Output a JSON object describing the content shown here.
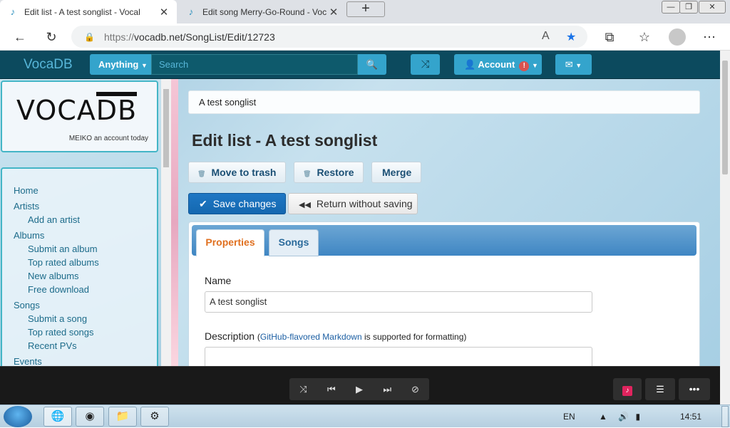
{
  "browser": {
    "tabs": [
      {
        "title": "Edit list - A test songlist - Vocal",
        "active": true
      },
      {
        "title": "Edit song Merry-Go-Round - Voc",
        "active": false
      }
    ],
    "url_prefix": "https://",
    "url_main": "vocadb.net/SongList/Edit/12723"
  },
  "navbar": {
    "brand": "VocaDB",
    "search_scope": "Anything",
    "search_placeholder": "Search",
    "account_label": "Account",
    "account_badge": "!"
  },
  "sidebar": {
    "logo_text": "VOCA",
    "logo_db": "DB",
    "logo_tagline": "MEIKO an account today",
    "nav": [
      {
        "label": "Home",
        "level": 0
      },
      {
        "label": "Artists",
        "level": 0
      },
      {
        "label": "Add an artist",
        "level": 1
      },
      {
        "label": "Albums",
        "level": 0
      },
      {
        "label": "Submit an album",
        "level": 1
      },
      {
        "label": "Top rated albums",
        "level": 1
      },
      {
        "label": "New albums",
        "level": 1
      },
      {
        "label": "Free download",
        "level": 1
      },
      {
        "label": "Songs",
        "level": 0
      },
      {
        "label": "Submit a song",
        "level": 1
      },
      {
        "label": "Top rated songs",
        "level": 1
      },
      {
        "label": "Recent PVs",
        "level": 1
      },
      {
        "label": "Events",
        "level": 0
      }
    ]
  },
  "content": {
    "breadcrumb": "A test songlist",
    "title": "Edit list - A test songlist",
    "actions": {
      "trash": "Move to trash",
      "restore": "Restore",
      "merge": "Merge"
    },
    "save_label": "Save changes",
    "return_label": "Return without saving",
    "tabs": [
      "Properties",
      "Songs"
    ],
    "name_label": "Name",
    "name_value": "A test songlist",
    "description_label": "Description",
    "markdown_link": "GitHub-flavored Markdown",
    "markdown_suffix": "is supported for formatting)",
    "markdown_prefix": "("
  },
  "taskbar": {
    "language": "EN",
    "time": "14:51"
  },
  "colors": {
    "navbar_bg": "#0c4a5e",
    "accent": "#34a4cc",
    "save_button": "#1f77c4",
    "active_tab_text": "#e07020"
  }
}
